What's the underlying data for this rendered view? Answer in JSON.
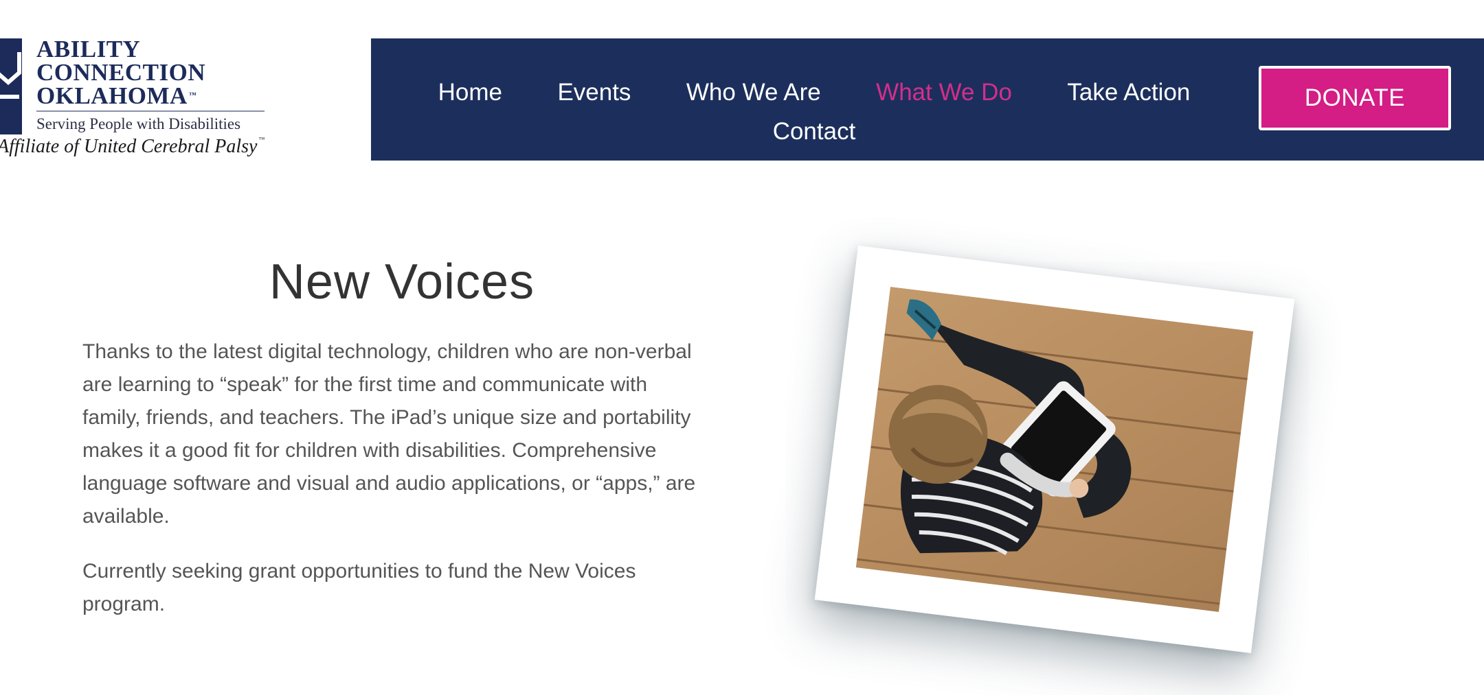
{
  "logo": {
    "line1": "ABILITY",
    "line2": "CONNECTION",
    "line3": "OKLAHOMA",
    "trademark": "™",
    "tagline": "Serving People with Disabilities",
    "affiliate": "Affiliate of United Cerebral Palsy",
    "colors": {
      "primary": "#1c2b5a"
    }
  },
  "nav": {
    "items": [
      {
        "label": "Home",
        "active": false
      },
      {
        "label": "Events",
        "active": false
      },
      {
        "label": "Who We Are",
        "active": false
      },
      {
        "label": "What We Do",
        "active": true
      },
      {
        "label": "Take Action",
        "active": false
      },
      {
        "label": "Contact",
        "active": false
      }
    ],
    "donate_label": "DONATE",
    "colors": {
      "background": "#1c2f5c",
      "active": "#d42e8c",
      "donate": "#d41d85"
    }
  },
  "main": {
    "title": "New Voices",
    "paragraphs": [
      "Thanks to the latest digital technology, children who are non-verbal are learning to “speak” for the first time and communicate with family, friends, and teachers. The iPad’s unique size and portability makes it a good fit for children with disabilities. Comprehensive language software and visual and audio applications, or “apps,” are available.",
      "Currently seeking grant opportunities to fund the New Voices program."
    ],
    "image": {
      "icon": "photo-child-with-tablet"
    }
  }
}
